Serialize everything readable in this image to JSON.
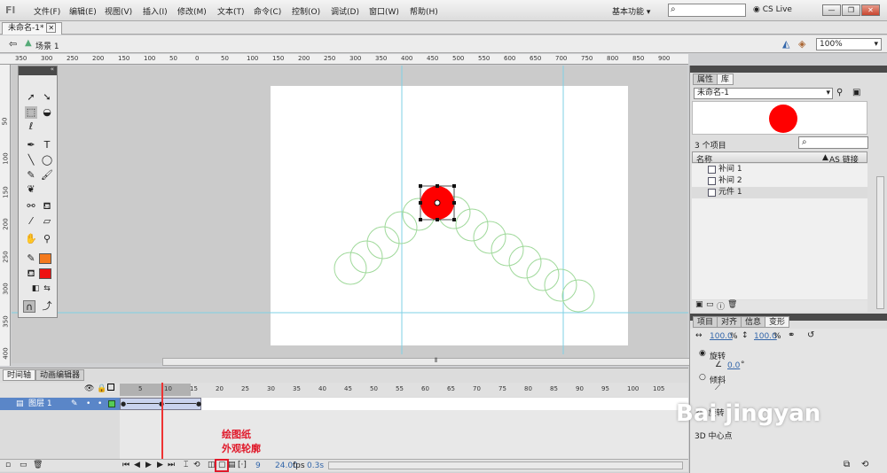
{
  "menu": {
    "logo": "Fl",
    "items": [
      "文件(F)",
      "编辑(E)",
      "视图(V)",
      "插入(I)",
      "修改(M)",
      "文本(T)",
      "命令(C)",
      "控制(O)",
      "调试(D)",
      "窗口(W)",
      "帮助(H)"
    ],
    "workspace": "基本功能",
    "cs_live": "CS Live"
  },
  "document": {
    "tab": "未命名-1*",
    "scene": "场景 1",
    "zoom": "100%"
  },
  "hruler_ticks": [
    "350",
    "300",
    "250",
    "200",
    "150",
    "100",
    "50",
    "0",
    "50",
    "100",
    "150",
    "200",
    "250",
    "300",
    "350",
    "400",
    "450",
    "500",
    "550",
    "600",
    "650",
    "700",
    "750",
    "800",
    "850",
    "900"
  ],
  "vruler_ticks": [
    "50",
    "100",
    "150",
    "200",
    "250",
    "300",
    "350",
    "400"
  ],
  "library": {
    "tabs": [
      "属性",
      "库"
    ],
    "active_tab": "库",
    "doc": "未命名-1",
    "count": "3 个项目",
    "col_name": "名称",
    "col_link": "AS 链接",
    "items": [
      {
        "name": "补间 1",
        "icon": "graphic-symbol-icon"
      },
      {
        "name": "补间 2",
        "icon": "graphic-symbol-icon"
      },
      {
        "name": "元件 1",
        "icon": "graphic-symbol-icon"
      }
    ]
  },
  "transform": {
    "tabs": [
      "项目",
      "对齐",
      "信息",
      "变形"
    ],
    "active_tab": "变形",
    "width_pct": "100.0",
    "height_pct": "100.0",
    "pct": "%",
    "rotate_label": "旋转",
    "rotate_value": "0.0",
    "degree": "°",
    "skew_label": "倾斜",
    "rot3d": "3D 旋转",
    "center3d": "3D 中心点"
  },
  "timeline": {
    "tabs": [
      "时间轴",
      "动画编辑器"
    ],
    "layer": "图层 1",
    "frame_numbers": [
      "5",
      "10",
      "15",
      "20",
      "25",
      "30",
      "35",
      "40",
      "45",
      "50",
      "55",
      "60",
      "65",
      "70",
      "75",
      "80",
      "85",
      "90",
      "95",
      "100",
      "105"
    ],
    "current_frame": "9",
    "fps": "24.00",
    "fps_unit": "fps",
    "time": "0.3s"
  },
  "annotation": {
    "line1": "绘图纸",
    "line2": "外观轮廓"
  },
  "watermark": "Bai jingyan",
  "colors": {
    "stroke": "#f47a1e",
    "fill": "#ee1111",
    "circle": "#ff0000",
    "onion": "#9fd99a",
    "guide": "#7fd0e6",
    "layer": "#5a86c8"
  }
}
